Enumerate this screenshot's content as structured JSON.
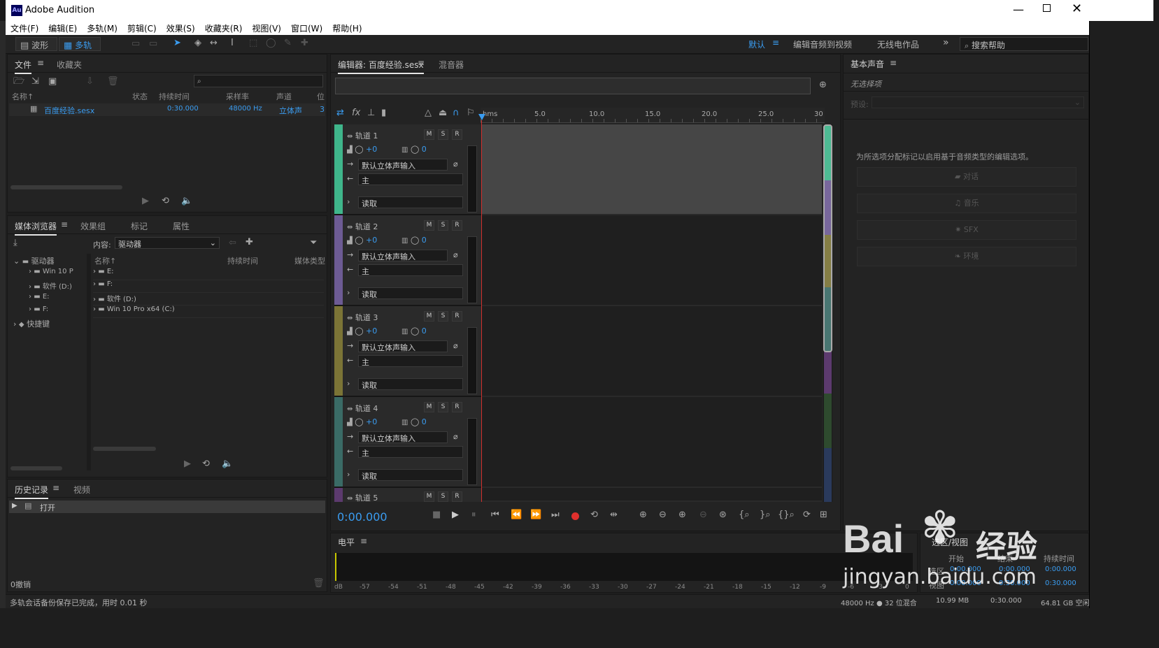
{
  "app": {
    "title": "Adobe Audition",
    "logo": "Au"
  },
  "menu": [
    "文件(F)",
    "编辑(E)",
    "多轨(M)",
    "剪辑(C)",
    "效果(S)",
    "收藏夹(R)",
    "视图(V)",
    "窗口(W)",
    "帮助(H)"
  ],
  "toolbar": {
    "waveform": "波形",
    "multitrack": "多轨",
    "workspace_default": "默认",
    "workspace_edit_video": "编辑音频到视频",
    "workspace_radio": "无线电作品",
    "search_placeholder": "搜索帮助",
    "more": "»"
  },
  "files_panel": {
    "tab_files": "文件",
    "tab_favorites": "收藏夹",
    "columns": [
      "名称↑",
      "状态",
      "持续时间",
      "采样率",
      "声道",
      "位"
    ],
    "row": {
      "name": "百度经验.sesx",
      "duration": "0:30.000",
      "sample_rate": "48000 Hz",
      "channels": "立体声",
      "bits": "3"
    }
  },
  "media_panel": {
    "tabs": [
      "媒体浏览器",
      "效果组",
      "标记",
      "属性"
    ],
    "content_label": "内容:",
    "content_value": "驱动器",
    "left_tree": [
      "驱动器",
      "Win 10 P",
      "软件 (D:)",
      "E:",
      "F:",
      "快捷键"
    ],
    "col_name": "名称↑",
    "col_duration": "持续时间",
    "col_mediatype": "媒体类型",
    "items": [
      "E:",
      "F:",
      "软件 (D:)",
      "Win 10 Pro x64 (C:)"
    ]
  },
  "history_panel": {
    "tab_history": "历史记录",
    "tab_video": "视频",
    "item": "打开",
    "undo_count": "0撤销"
  },
  "editor": {
    "tab_editor": "编辑器: 百度经验.sesx",
    "tab_mixer": "混音器",
    "time": "0:00.000",
    "ruler": [
      "hms",
      "5.0",
      "10.0",
      "15.0",
      "20.0",
      "25.0",
      "30"
    ]
  },
  "tracks": [
    {
      "name": "轨道 1",
      "vol": "+0",
      "pan": "0",
      "input": "默认立体声输入",
      "output": "主",
      "automation": "读取",
      "color": "#3fb68b"
    },
    {
      "name": "轨道 2",
      "vol": "+0",
      "pan": "0",
      "input": "默认立体声输入",
      "output": "主",
      "automation": "读取",
      "color": "#6d5b94"
    },
    {
      "name": "轨道 3",
      "vol": "+0",
      "pan": "0",
      "input": "默认立体声输入",
      "output": "主",
      "automation": "读取",
      "color": "#7b7436"
    },
    {
      "name": "轨道 4",
      "vol": "+0",
      "pan": "0",
      "input": "默认立体声输入",
      "output": "主",
      "automation": "读取",
      "color": "#3a6b66"
    },
    {
      "name": "轨道 5",
      "color": "#5c3a6e"
    }
  ],
  "track_buttons": {
    "m": "M",
    "s": "S",
    "r": "R"
  },
  "level_panel": {
    "title": "电平",
    "scale": [
      "dB",
      "-57",
      "-54",
      "-51",
      "-48",
      "-45",
      "-42",
      "-39",
      "-36",
      "-33",
      "-30",
      "-27",
      "-24",
      "-21",
      "-18",
      "-15",
      "-12",
      "-9",
      "-6",
      "-3",
      "0"
    ]
  },
  "essential_sound": {
    "title": "基本声音",
    "no_selection": "无选择项",
    "preset_label": "预设:",
    "hint": "为所选项分配标记以启用基于音频类型的编辑选项。",
    "buttons": [
      "对话",
      "音乐",
      "SFX",
      "环境"
    ]
  },
  "selection_panel": {
    "title": "选区/视图",
    "col_start": "开始",
    "col_end": "结束",
    "col_duration": "持续时间",
    "row_sel": "选区",
    "row_view": "视图",
    "sel_start": "0:00.000",
    "sel_end": "0:00.000",
    "sel_dur": "0:00.000",
    "view_start": "0:00.000",
    "view_end": "0:30.000",
    "view_dur": "0:30.000"
  },
  "status": {
    "message": "多轨会话备份保存已完成，用时 0.01 秒",
    "format": "48000 Hz ● 32 位混合",
    "size": "10.99 MB",
    "duration": "0:30.000",
    "free": "64.81 GB 空闲"
  },
  "watermark": {
    "brand": "Bai",
    "brand2": "经验",
    "url": "jingyan.baidu.com"
  },
  "colors": {
    "accent": "#3a9cf0",
    "playhead": "#d0302d",
    "record": "#e0302d"
  }
}
